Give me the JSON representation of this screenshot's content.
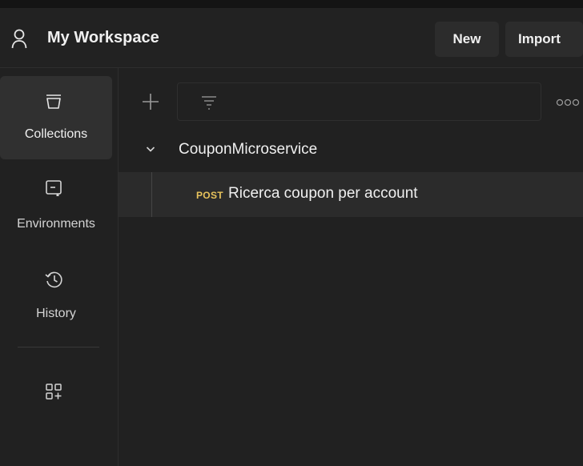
{
  "header": {
    "workspace_title": "My Workspace",
    "new_label": "New",
    "import_label": "Import",
    "user_icon": "user-icon"
  },
  "sidebar": {
    "items": [
      {
        "label": "Collections",
        "icon": "collections-icon",
        "active": true
      },
      {
        "label": "Environments",
        "icon": "environments-icon",
        "active": false
      },
      {
        "label": "History",
        "icon": "history-icon",
        "active": false
      }
    ],
    "extra_icon": "add-workbench-icon"
  },
  "toolbar": {
    "add_icon": "plus-icon",
    "filter_icon": "filter-icon",
    "search_value": "",
    "more_icon": "more-options-icon"
  },
  "tree": {
    "collection": {
      "name": "CouponMicroservice",
      "expanded": true
    },
    "requests": [
      {
        "method": "POST",
        "name": "Ricerca coupon per account"
      }
    ]
  },
  "colors": {
    "background": "#212121",
    "active_item": "#303030",
    "selected_row": "#2b2b2b",
    "post_method": "#e8c35c"
  }
}
